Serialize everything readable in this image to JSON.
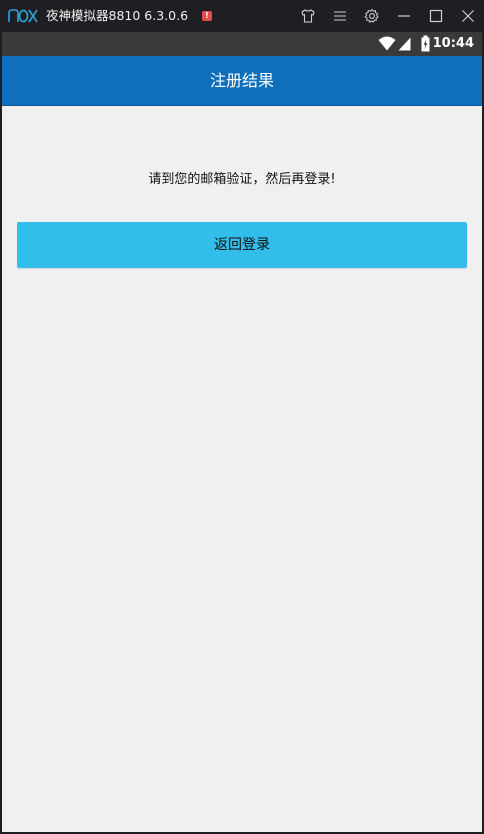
{
  "window": {
    "title": "夜神模拟器8810 6.3.0.6"
  },
  "statusbar": {
    "time": "10:44"
  },
  "app": {
    "title": "注册结果",
    "message": "请到您的邮箱验证，然后再登录!",
    "back_button_label": "返回登录"
  },
  "colors": {
    "titlebar_bg": "#1f1f23",
    "appbar_bg": "#0f6fba",
    "page_bg": "#f0f0f0",
    "button_bg": "#33bdeb",
    "logo": "#2aa7dc",
    "alert": "#e84a4a"
  },
  "icons": {
    "logo": "nox-logo-icon",
    "alert": "alert-icon",
    "skin": "shirt-icon",
    "menu": "menu-icon",
    "settings": "gear-icon",
    "minimize": "minimize-icon",
    "maximize": "maximize-icon",
    "close": "close-icon",
    "wifi": "wifi-icon",
    "signal": "signal-icon",
    "battery": "battery-icon"
  }
}
